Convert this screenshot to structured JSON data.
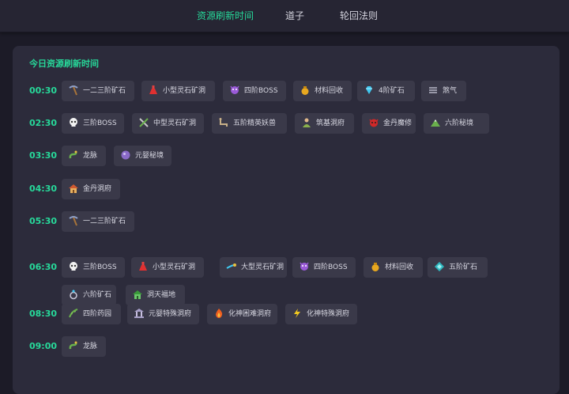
{
  "nav": {
    "tabs": [
      {
        "label": "资源刷新时间",
        "active": true
      },
      {
        "label": "道子",
        "active": false
      },
      {
        "label": "轮回法则",
        "active": false
      }
    ]
  },
  "panel": {
    "title": "今日资源刷新时间",
    "rows": [
      {
        "time": "00:30",
        "items": [
          {
            "icon": "pickaxe-icon",
            "label": "一二三阶矿石"
          },
          {
            "icon": "red-flask-icon",
            "label": "小型灵石矿洞"
          },
          {
            "icon": "purple-monster-icon",
            "label": "四阶BOSS"
          },
          {
            "icon": "money-bag-icon",
            "label": "材料回收"
          },
          {
            "icon": "diamond-icon",
            "label": "4阶矿石"
          },
          {
            "icon": "mist-icon",
            "label": "煞气"
          }
        ]
      },
      {
        "time": "02:30",
        "items": [
          {
            "icon": "skull-icon",
            "label": "三阶BOSS"
          },
          {
            "icon": "crossed-tools-icon",
            "label": "中型灵石矿洞"
          },
          {
            "icon": "sauropod-icon",
            "label": "五阶精英妖兽"
          },
          {
            "icon": "cultivator-icon",
            "label": "筑基洞府"
          },
          {
            "icon": "demon-mask-icon",
            "label": "金丹魔修"
          },
          {
            "icon": "mountain-icon",
            "label": "六阶秘境"
          }
        ]
      },
      {
        "time": "03:30",
        "items": [
          {
            "icon": "dragon-icon",
            "label": "龙脉"
          },
          {
            "icon": "purple-orb-icon",
            "label": "元婴秘境"
          }
        ]
      },
      {
        "time": "04:30",
        "items": [
          {
            "icon": "house-icon",
            "label": "金丹洞府"
          }
        ]
      },
      {
        "time": "05:30",
        "items": [
          {
            "icon": "pickaxe-icon",
            "label": "一二三阶矿石"
          }
        ]
      },
      {
        "time": "06:30",
        "items": [
          {
            "icon": "skull-icon",
            "label": "三阶BOSS"
          },
          {
            "icon": "red-flask-icon",
            "label": "小型灵石矿洞"
          },
          {
            "icon": "comet-icon",
            "label": "大型灵石矿洞"
          },
          {
            "icon": "purple-monster-icon",
            "label": "四阶BOSS"
          },
          {
            "icon": "money-bag-icon",
            "label": "材料回收"
          },
          {
            "icon": "teal-gem-icon",
            "label": "五阶矿石"
          },
          {
            "icon": "ring-icon",
            "label": "六阶矿石"
          },
          {
            "icon": "green-house-icon",
            "label": "洞天福地"
          }
        ]
      },
      {
        "time": "08:30",
        "items": [
          {
            "icon": "herb-icon",
            "label": "四阶药园"
          },
          {
            "icon": "temple-icon",
            "label": "元婴特殊洞府"
          },
          {
            "icon": "fire-icon",
            "label": "化神困难洞府"
          },
          {
            "icon": "lightning-icon",
            "label": "化神特殊洞府"
          }
        ]
      },
      {
        "time": "09:00",
        "items": [
          {
            "icon": "dragon-icon",
            "label": "龙脉"
          }
        ]
      }
    ]
  }
}
